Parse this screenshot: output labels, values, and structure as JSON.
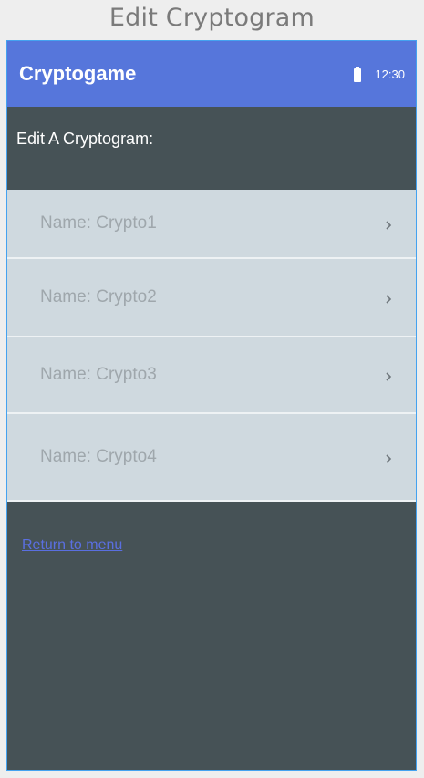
{
  "page": {
    "title": "Edit Cryptogram"
  },
  "app_bar": {
    "title": "Cryptogame",
    "battery_icon": "battery-full-icon",
    "time": "12:30"
  },
  "main": {
    "heading": "Edit A Cryptogram:",
    "items": [
      {
        "label": "Name: Crypto1",
        "icon": "chevron-right-icon"
      },
      {
        "label": "Name: Crypto2",
        "icon": "chevron-right-icon"
      },
      {
        "label": "Name: Crypto3",
        "icon": "chevron-right-icon"
      },
      {
        "label": "Name: Crypto4",
        "icon": "chevron-right-icon"
      }
    ],
    "return_link": "Return to menu"
  },
  "colors": {
    "app_bar": "#5676db",
    "background": "#465256",
    "list_item": "#cfd9df",
    "link": "#5a6fe0"
  }
}
